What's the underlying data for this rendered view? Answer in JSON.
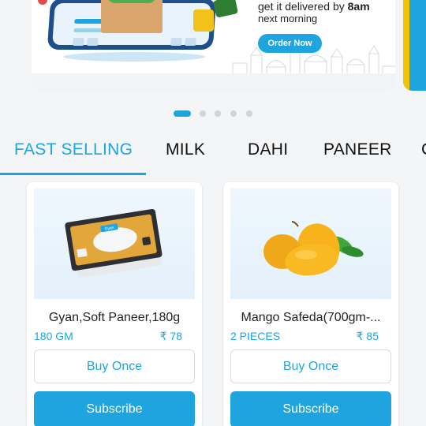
{
  "banner": {
    "headline_prefix": "get it delivered by ",
    "headline_bold": "8am",
    "subline": "next morning",
    "cta_label": "Order Now"
  },
  "carousel": {
    "slide_count": 5,
    "active_index": 0
  },
  "tabs": [
    {
      "label": "FAST SELLING",
      "active": true
    },
    {
      "label": "MILK",
      "active": false
    },
    {
      "label": "DAHI",
      "active": false
    },
    {
      "label": "PANEER",
      "active": false
    },
    {
      "label": "C",
      "active": false
    }
  ],
  "products": [
    {
      "name": "Gyan,Soft Paneer,180g",
      "quantity": "180 GM",
      "price": "₹ 78",
      "buy_label": "Buy Once",
      "subscribe_label": "Subscribe",
      "package_brand": "Gyan"
    },
    {
      "name": "Mango Safeda(700gm-...",
      "quantity": "2 PIECES",
      "price": "₹ 85",
      "buy_label": "Buy Once",
      "subscribe_label": "Subscribe"
    }
  ],
  "colors": {
    "accent": "#1ea5e0",
    "background": "#f4f5f7",
    "card": "#ffffff"
  }
}
